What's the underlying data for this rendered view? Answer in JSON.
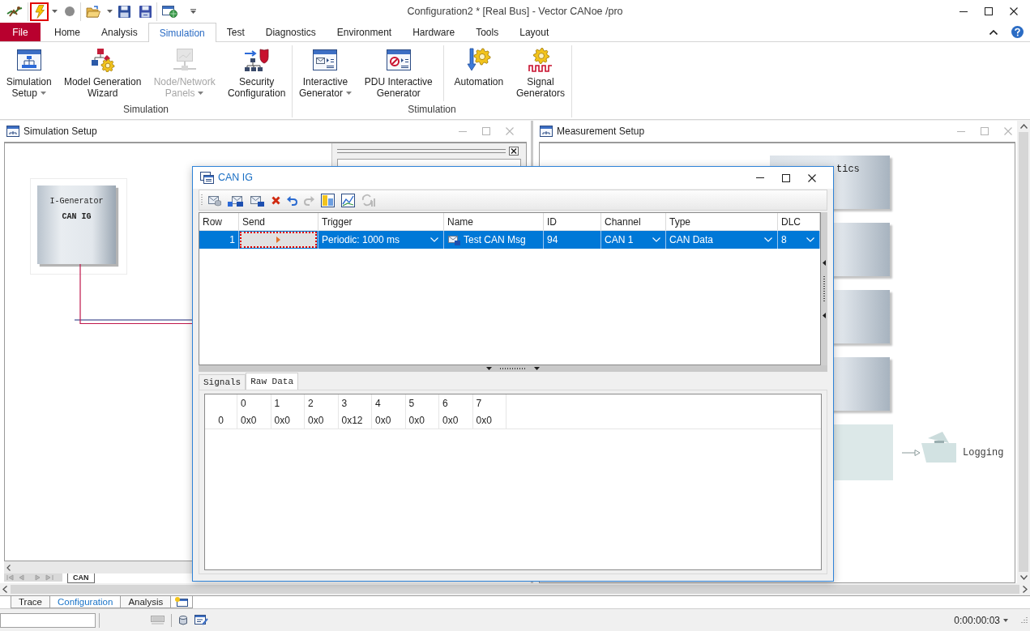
{
  "window": {
    "title": "Configuration2 * [Real Bus] - Vector CANoe /pro"
  },
  "quick_access": [
    [
      {
        "kind": "app",
        "highlighted": false,
        "dropdown": false
      }
    ],
    [
      {
        "kind": "start",
        "highlighted": true,
        "dropdown": true
      },
      {
        "kind": "stop",
        "highlighted": false,
        "dropdown": false
      }
    ],
    [
      {
        "kind": "open",
        "highlighted": false,
        "dropdown": true
      },
      {
        "kind": "save",
        "highlighted": false,
        "dropdown": false
      },
      {
        "kind": "save_all",
        "highlighted": false,
        "dropdown": false
      }
    ],
    [
      {
        "kind": "options",
        "highlighted": false,
        "dropdown": false
      }
    ]
  ],
  "ribbon": {
    "tabs": [
      {
        "label": "File",
        "kind": "file",
        "selected": false
      },
      {
        "label": "Home",
        "kind": "tab",
        "selected": false
      },
      {
        "label": "Analysis",
        "kind": "tab",
        "selected": false
      },
      {
        "label": "Simulation",
        "kind": "tab",
        "selected": true
      },
      {
        "label": "Test",
        "kind": "tab",
        "selected": false
      },
      {
        "label": "Diagnostics",
        "kind": "tab",
        "selected": false
      },
      {
        "label": "Environment",
        "kind": "tab",
        "selected": false
      },
      {
        "label": "Hardware",
        "kind": "tab",
        "selected": false
      },
      {
        "label": "Tools",
        "kind": "tab",
        "selected": false
      },
      {
        "label": "Layout",
        "kind": "tab",
        "selected": false
      }
    ],
    "groups": [
      {
        "label": "Simulation",
        "buttons": [
          {
            "kind": "simulation_setup",
            "label_lines": [
              "Simulation",
              "Setup"
            ],
            "dropdown": true,
            "disabled": false,
            "separator_before": false
          },
          {
            "kind": "model_generation",
            "label_lines": [
              "Model Generation",
              "Wizard"
            ],
            "dropdown": false,
            "disabled": false,
            "separator_before": false
          },
          {
            "kind": "node_network_panels",
            "label_lines": [
              "Node/Network",
              "Panels"
            ],
            "dropdown": true,
            "disabled": true,
            "separator_before": false
          },
          {
            "kind": "security_configuration",
            "label_lines": [
              "Security",
              "Configuration"
            ],
            "dropdown": false,
            "disabled": false,
            "separator_before": false
          }
        ]
      },
      {
        "label": "Stimulation",
        "buttons": [
          {
            "kind": "interactive_generator",
            "label_lines": [
              "Interactive",
              "Generator"
            ],
            "dropdown": true,
            "disabled": false,
            "separator_before": false
          },
          {
            "kind": "pdu_interactive_generator",
            "label_lines": [
              "PDU Interactive",
              "Generator"
            ],
            "dropdown": false,
            "disabled": false,
            "separator_before": false
          },
          {
            "kind": "automation",
            "label_lines": [
              "Automation"
            ],
            "dropdown": false,
            "disabled": false,
            "separator_before": true
          },
          {
            "kind": "signal_generators",
            "label_lines": [
              "Signal",
              "Generators"
            ],
            "dropdown": false,
            "disabled": false,
            "separator_before": false
          }
        ]
      }
    ]
  },
  "simulation_setup": {
    "title": "Simulation Setup",
    "active": false,
    "node": {
      "type_label": "I-Generator",
      "name": "CAN IG"
    },
    "bus_tab": "CAN"
  },
  "measurement_setup": {
    "title": "Measurement Setup",
    "active": false,
    "blocks": [
      {
        "kind": "function",
        "label": "tics"
      },
      {
        "kind": "function"
      },
      {
        "kind": "function"
      },
      {
        "kind": "function"
      },
      {
        "kind": "shaded"
      }
    ],
    "logging": {
      "label": "Logging"
    }
  },
  "can_ig": {
    "title": "CAN IG",
    "active": true,
    "toolbar": [
      {
        "kind": "add_message",
        "disabled": false
      },
      {
        "kind": "add_fd_message",
        "disabled": false
      },
      {
        "kind": "add_id_message",
        "disabled": false
      },
      {
        "kind": "delete",
        "disabled": false
      },
      {
        "kind": "undo",
        "disabled": false
      },
      {
        "kind": "redo",
        "disabled": true
      },
      {
        "kind": "panel",
        "disabled": false
      },
      {
        "kind": "chart",
        "disabled": false
      },
      {
        "kind": "refresh",
        "disabled": true
      }
    ],
    "table": {
      "columns": [
        "Row",
        "Send",
        "Trigger",
        "Name",
        "ID",
        "Channel",
        "Type",
        "DLC"
      ],
      "rows": [
        {
          "selected": true,
          "cells": [
            {
              "kind": "number",
              "text": "1"
            },
            {
              "kind": "send",
              "highlighted": true
            },
            {
              "kind": "dropdown",
              "text": "Periodic: 1000 ms"
            },
            {
              "kind": "message",
              "text": "Test CAN Msg"
            },
            {
              "kind": "text",
              "text": "94"
            },
            {
              "kind": "dropdown",
              "text": "CAN 1"
            },
            {
              "kind": "dropdown",
              "text": "CAN Data"
            },
            {
              "kind": "dropdown",
              "text": "8"
            }
          ]
        }
      ]
    },
    "detail_tabs": [
      {
        "label": "Signals",
        "selected": false
      },
      {
        "label": "Raw Data",
        "selected": true
      }
    ],
    "raw_data": {
      "columns": [
        "0",
        "1",
        "2",
        "3",
        "4",
        "5",
        "6",
        "7"
      ],
      "rows": [
        {
          "label": "0",
          "values": [
            "0x0",
            "0x0",
            "0x0",
            "0x12",
            "0x0",
            "0x0",
            "0x0",
            "0x0"
          ]
        }
      ]
    }
  },
  "bottom_tabs": [
    {
      "label": "Trace",
      "selected": false
    },
    {
      "label": "Configuration",
      "selected": true
    },
    {
      "label": "Analysis",
      "selected": false
    }
  ],
  "status_bar": {
    "time": "0:00:00:03"
  }
}
